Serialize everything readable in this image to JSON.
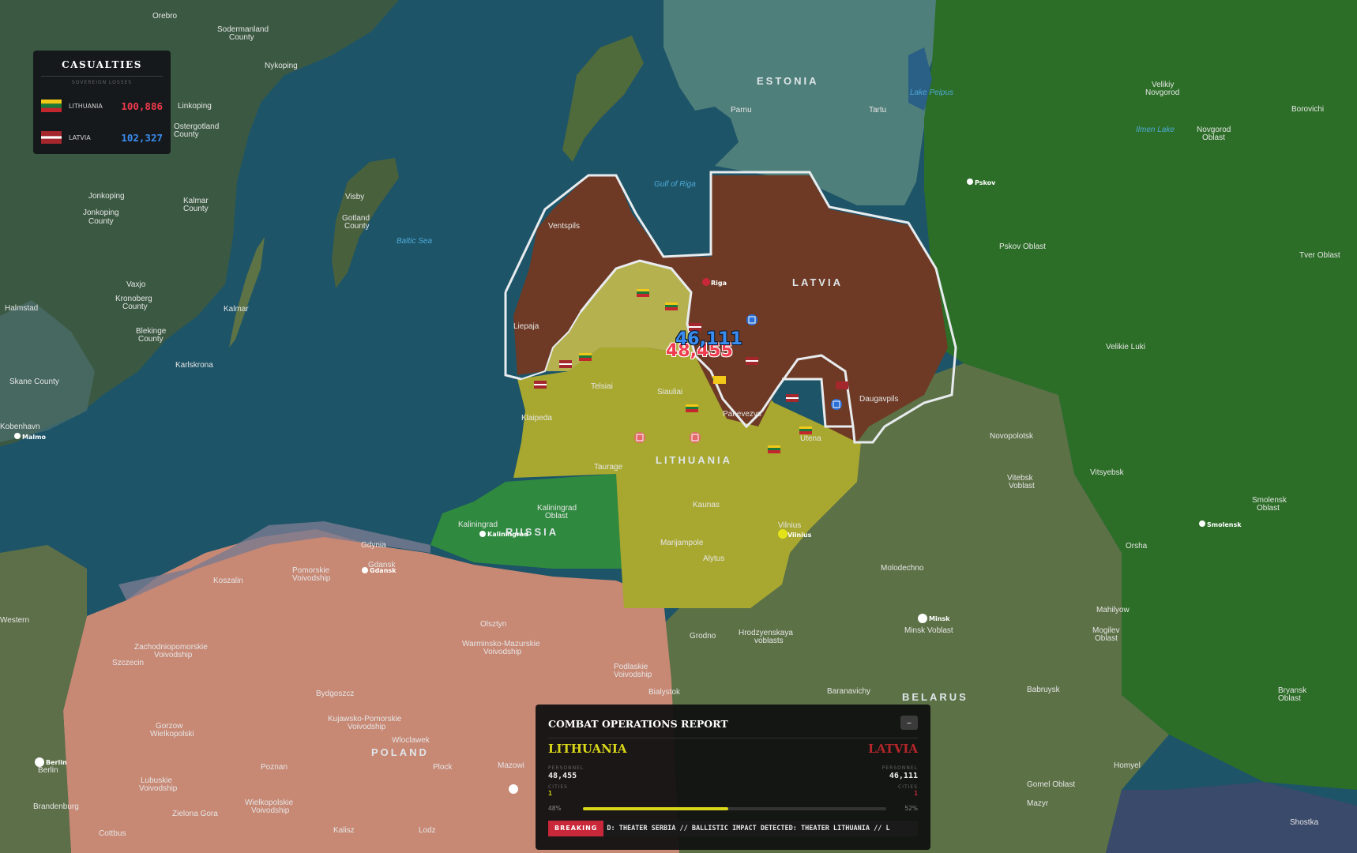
{
  "casualties": {
    "title": "CASUALTIES",
    "subtitle": "SOVEREIGN LOSSES",
    "rows": [
      {
        "name": "LITHUANIA",
        "value": "100,886",
        "color": "#f03a4e"
      },
      {
        "name": "LATVIA",
        "value": "102,327",
        "color": "#3a8df0"
      }
    ]
  },
  "front": {
    "latvia_value": "46,111",
    "lithuania_value": "48,455"
  },
  "report": {
    "title": "COMBAT OPERATIONS REPORT",
    "minimize_label": "–",
    "left_side": "LITHUANIA",
    "right_side": "LATVIA",
    "personnel_label": "PERSONNEL",
    "cities_label": "CITIES",
    "left_personnel": "48,455",
    "right_personnel": "46,111",
    "left_cities": "1",
    "right_cities": "1",
    "left_pct": "48%",
    "right_pct": "52%",
    "left_share": 0.48,
    "breaking_label": "BREAKING",
    "ticker": "D: THEATER SERBIA // BALLISTIC IMPACT DETECTED: THEATER LITHUANIA // L"
  },
  "map_labels": {
    "countries": [
      "ESTONIA",
      "LATVIA",
      "LITHUANIA",
      "RUSSIA",
      "POLAND",
      "BELARUS"
    ],
    "water": [
      "Gulf of Riga",
      "Baltic Sea",
      "Lake Peipus",
      "Ilmen Lake"
    ],
    "places": [
      "Orebro",
      "Sodermanland County",
      "Nykoping",
      "Linkoping",
      "Ostergotland County",
      "Jonkoping",
      "Jonkoping County",
      "Kalmar County",
      "Visby",
      "Gotland County",
      "Vaxjo",
      "Kronoberg County",
      "Halmstad",
      "Kalmar",
      "Blekinge County",
      "Karlskrona",
      "Skane County",
      "Kobenhavn",
      "Parnu",
      "Tartu",
      "Velikiy Novgorod",
      "Borovichi",
      "Novgorod Oblast",
      "Pskov Oblast",
      "Tver Oblast",
      "Velikie Luki",
      "Ventspils",
      "Riga",
      "Liepaja",
      "Telsiai",
      "Siauliai",
      "Panevezys",
      "Daugavpils",
      "Klaipeda",
      "Utena",
      "Taurage",
      "Kaunas",
      "Vilnius",
      "Marijampole",
      "Alytus",
      "Kaliningrad Oblast",
      "Kaliningrad",
      "Novopolotsk",
      "Vitebsk Oblast",
      "Vitsyebsk",
      "Smolensk Oblast",
      "Smolensk",
      "Orsha",
      "Molodechno",
      "Minsk",
      "Minsk Oblast",
      "Mahilyow",
      "Mogilev Oblast",
      "Grodno",
      "Hrodzyenskaya voblasts",
      "Baranavichy",
      "Babruysk",
      "Bryansk Oblast",
      "Homyel",
      "Gomel Oblast",
      "Mazyr",
      "Shostka",
      "Gdynia",
      "Gdansk",
      "Koszalin",
      "Pomorskie Voivodship",
      "Olsztyn",
      "Warminsko-Mazurskie Voivodship",
      "Zachodniopomorskie Voivodship",
      "Szczecin",
      "Bydgoszcz",
      "Kujawsko-Pomorskie Voivodship",
      "Podlaskie Voivodship",
      "Bialystok",
      "Gorzow Wielkopolski",
      "Wloclawek",
      "Poznan",
      "Plock",
      "Mazowieckie",
      "Lubuskie Voivodship",
      "Wielkopolskie Voivodship",
      "Brandenburg",
      "Berlin",
      "Zielona Gora",
      "Lodz",
      "Kalisz",
      "Cottbus",
      "Western",
      "Malmo"
    ]
  }
}
